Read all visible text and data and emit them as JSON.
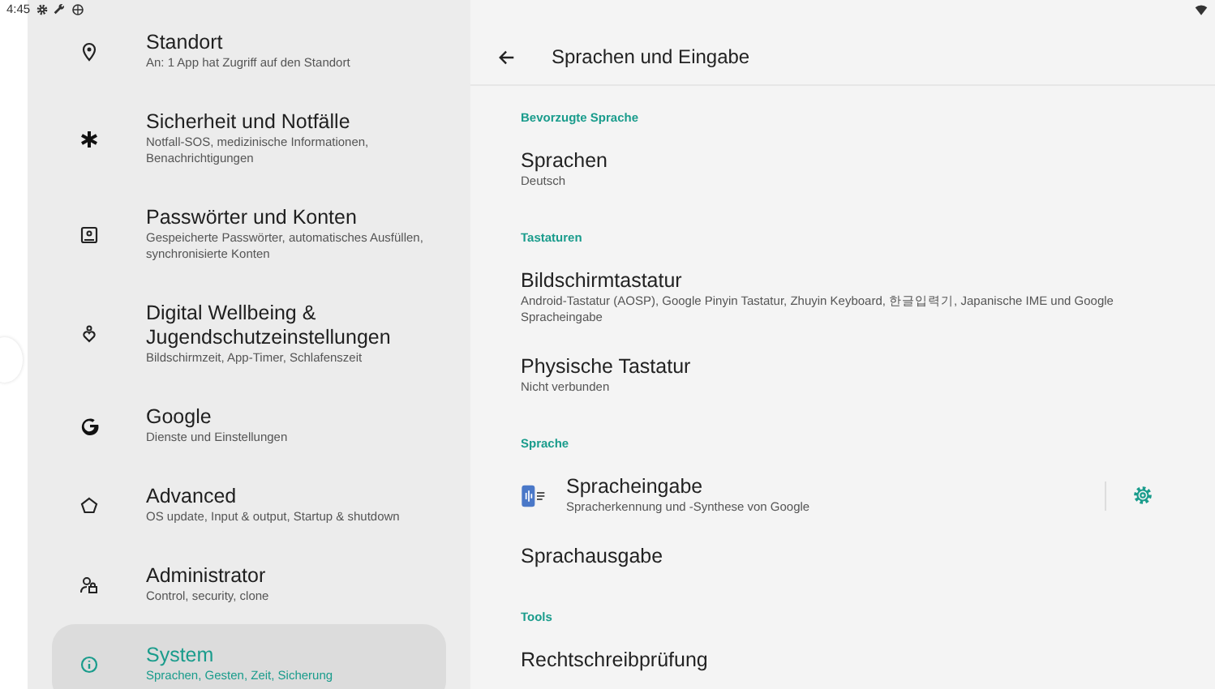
{
  "status_bar": {
    "time": "4:45"
  },
  "sidebar": {
    "items": [
      {
        "title": "Standort",
        "subtitle": "An: 1 App hat Zugriff auf den Standort",
        "selected": false
      },
      {
        "title": "Sicherheit und Notfälle",
        "subtitle": "Notfall-SOS, medizinische Informationen, Benachrichtigungen",
        "selected": false
      },
      {
        "title": "Passwörter und Konten",
        "subtitle": "Gespeicherte Passwörter, automatisches Ausfüllen, synchronisierte Konten",
        "selected": false
      },
      {
        "title": "Digital Wellbeing & Jugendschutzeinstellungen",
        "subtitle": "Bildschirmzeit, App-Timer, Schlafenszeit",
        "selected": false
      },
      {
        "title": "Google",
        "subtitle": "Dienste und Einstellungen",
        "selected": false
      },
      {
        "title": "Advanced",
        "subtitle": "OS update, Input & output, Startup & shutdown",
        "selected": false
      },
      {
        "title": "Administrator",
        "subtitle": "Control, security, clone",
        "selected": false
      },
      {
        "title": "System",
        "subtitle": "Sprachen, Gesten, Zeit, Sicherung",
        "selected": true
      }
    ]
  },
  "header": {
    "title": "Sprachen und Eingabe"
  },
  "sections": [
    {
      "heading": "Bevorzugte Sprache",
      "items": [
        {
          "kind": "plain",
          "title": "Sprachen",
          "subtitle": "Deutsch"
        }
      ]
    },
    {
      "heading": "Tastaturen",
      "items": [
        {
          "kind": "plain",
          "title": "Bildschirmtastatur",
          "subtitle": "Android-Tastatur (AOSP), Google Pinyin Tastatur, Zhuyin Keyboard, 한글입력기, Japanische IME und Google Spracheingabe"
        },
        {
          "kind": "plain",
          "title": "Physische Tastatur",
          "subtitle": "Nicht verbunden"
        }
      ]
    },
    {
      "heading": "Sprache",
      "items": [
        {
          "kind": "app",
          "title": "Spracheingabe",
          "subtitle": "Spracherkennung und -Synthese von Google"
        },
        {
          "kind": "plain",
          "title": "Sprachausgabe"
        }
      ]
    },
    {
      "heading": "Tools",
      "items": [
        {
          "kind": "plain",
          "title": "Rechtschreibprüfung"
        }
      ]
    }
  ]
}
